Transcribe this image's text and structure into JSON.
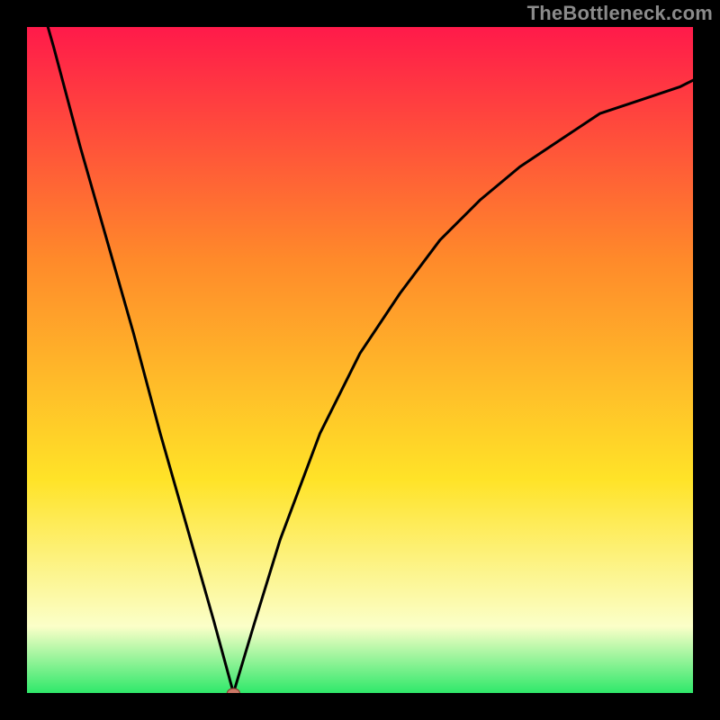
{
  "watermark": "TheBottleneck.com",
  "colors": {
    "frame": "#000000",
    "gradient_top": "#ff1a4a",
    "gradient_mid1": "#ff8a2a",
    "gradient_mid2": "#ffe328",
    "gradient_band": "#fbffc8",
    "gradient_bottom": "#2fe86a",
    "curve": "#000000",
    "marker_fill": "#cc7766",
    "marker_stroke": "#8a3f33"
  },
  "chart_data": {
    "type": "line",
    "title": "",
    "xlabel": "",
    "ylabel": "",
    "xlim": [
      0,
      100
    ],
    "ylim": [
      0,
      100
    ],
    "grid": false,
    "legend": false,
    "note": "axes are unlabeled; values estimated from pixel positions on a 0–100 normalized scale; minimum (vertex) near x≈31, y≈0",
    "series": [
      {
        "name": "curve",
        "x": [
          0,
          4,
          8,
          12,
          16,
          20,
          24,
          28,
          31,
          34,
          38,
          44,
          50,
          56,
          62,
          68,
          74,
          80,
          86,
          92,
          98,
          100
        ],
        "y": [
          111,
          97,
          82,
          68,
          54,
          39,
          25,
          11,
          0,
          10,
          23,
          39,
          51,
          60,
          68,
          74,
          79,
          83,
          87,
          89,
          91,
          92
        ]
      }
    ],
    "marker": {
      "x": 31,
      "y": 0
    }
  }
}
